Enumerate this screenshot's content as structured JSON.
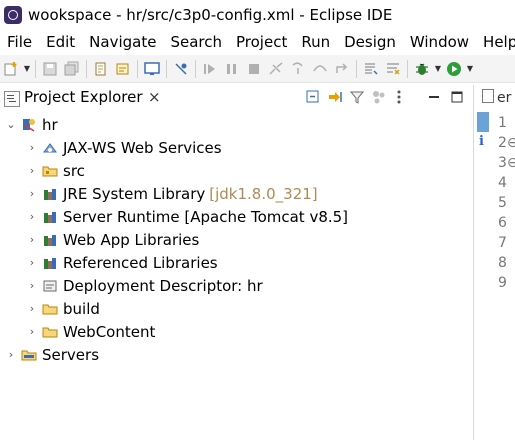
{
  "window": {
    "title": "wookspace - hr/src/c3p0-config.xml - Eclipse IDE"
  },
  "menu": [
    "File",
    "Edit",
    "Navigate",
    "Search",
    "Project",
    "Run",
    "Design",
    "Window",
    "Help"
  ],
  "explorer": {
    "title": "Project Explorer",
    "close": "×",
    "project": "hr",
    "children": [
      {
        "label": "JAX-WS Web Services",
        "icon": "web-services-icon"
      },
      {
        "label": "src",
        "icon": "source-folder-icon"
      },
      {
        "label": "JRE System Library",
        "decoration": "[jdk1.8.0_321]",
        "icon": "library-icon"
      },
      {
        "label": "Server Runtime [Apache Tomcat v8.5]",
        "icon": "library-icon"
      },
      {
        "label": "Web App Libraries",
        "icon": "library-icon"
      },
      {
        "label": "Referenced Libraries",
        "icon": "library-icon"
      },
      {
        "label": "Deployment Descriptor: hr",
        "icon": "deployment-descriptor-icon"
      },
      {
        "label": "build",
        "icon": "folder-icon"
      },
      {
        "label": "WebContent",
        "icon": "folder-icon"
      }
    ],
    "servers": "Servers"
  },
  "editor": {
    "tab_label": "er",
    "line_numbers": [
      "1",
      "2⊖",
      "3⊖",
      "4",
      "5",
      "6",
      "7",
      "8",
      "9"
    ]
  }
}
